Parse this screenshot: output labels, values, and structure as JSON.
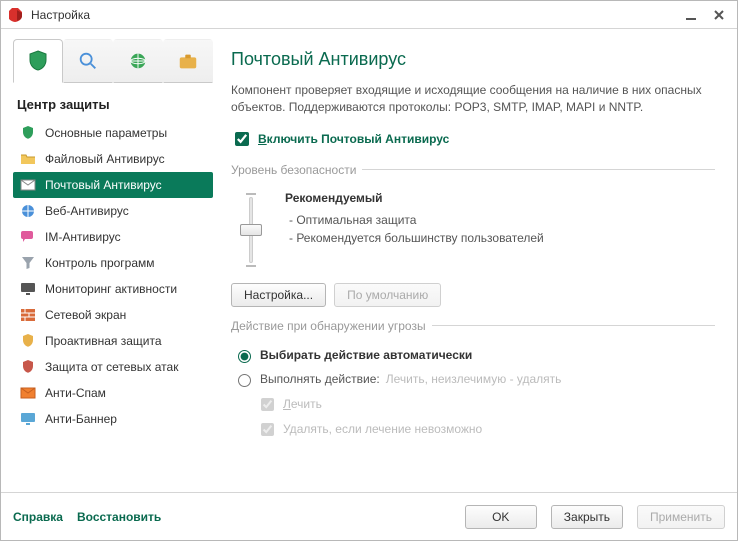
{
  "window": {
    "title": "Настройка"
  },
  "tabs": {
    "section_title": "Центр защиты"
  },
  "sidebar": {
    "items": [
      {
        "label": "Основные параметры"
      },
      {
        "label": "Файловый Антивирус"
      },
      {
        "label": "Почтовый Антивирус"
      },
      {
        "label": "Веб-Антивирус"
      },
      {
        "label": "IM-Антивирус"
      },
      {
        "label": "Контроль программ"
      },
      {
        "label": "Мониторинг активности"
      },
      {
        "label": "Сетевой экран"
      },
      {
        "label": "Проактивная защита"
      },
      {
        "label": "Защита от сетевых атак"
      },
      {
        "label": "Анти-Спам"
      },
      {
        "label": "Анти-Баннер"
      }
    ]
  },
  "page": {
    "title": "Почтовый Антивирус",
    "description": "Компонент проверяет входящие и исходящие сообщения на наличие в них опасных объектов. Поддерживаются протоколы: POP3, SMTP, IMAP, MAPI и NNTP.",
    "enable_prefix": "В",
    "enable_rest": "ключить Почтовый Антивирус",
    "group_security": "Уровень безопасности",
    "level_name": "Рекомендуемый",
    "level_line1": "- Оптимальная защита",
    "level_line2": "- Рекомендуется большинству пользователей",
    "btn_settings": "Настройка...",
    "btn_default": "По умолчанию",
    "group_action": "Действие при обнаружении угрозы",
    "radio_auto": "Выбирать действие автоматически",
    "radio_manual": "Выполнять действие:",
    "radio_manual_suffix": "Лечить, неизлечимую - удалять",
    "chk_cure": "Лечить",
    "chk_delete": "Удалять, если лечение невозможно"
  },
  "footer": {
    "help": "Справка",
    "restore": "Восстановить",
    "ok": "OK",
    "close": "Закрыть",
    "apply": "Применить"
  }
}
